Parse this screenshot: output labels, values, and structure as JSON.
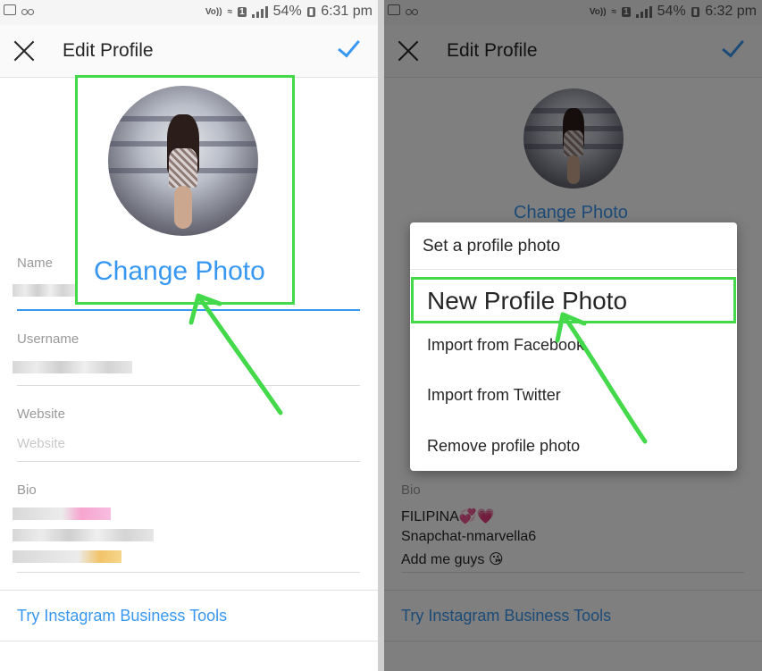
{
  "left": {
    "status": {
      "battery": "54%",
      "time": "6:31 pm"
    },
    "appbar": {
      "title": "Edit Profile"
    },
    "change_photo": "Change Photo",
    "fields": {
      "name_label": "Name",
      "username_label": "Username",
      "website_label": "Website",
      "website_placeholder": "Website",
      "bio_label": "Bio"
    },
    "business_link": "Try Instagram Business Tools"
  },
  "right": {
    "status": {
      "battery": "54%",
      "time": "6:32 pm"
    },
    "appbar": {
      "title": "Edit Profile"
    },
    "change_photo": "Change Photo",
    "dialog": {
      "title": "Set a profile photo",
      "items": [
        "New Profile Photo",
        "Import from Facebook",
        "Import from Twitter",
        "Remove profile photo"
      ]
    },
    "bio_label": "Bio",
    "bio_lines": [
      "FILIPINA",
      "Snapchat-nmarvella6",
      "Add me guys"
    ],
    "business_link": "Try Instagram Business Tools"
  },
  "colors": {
    "accent": "#3897f0",
    "highlight": "#44d94a"
  }
}
